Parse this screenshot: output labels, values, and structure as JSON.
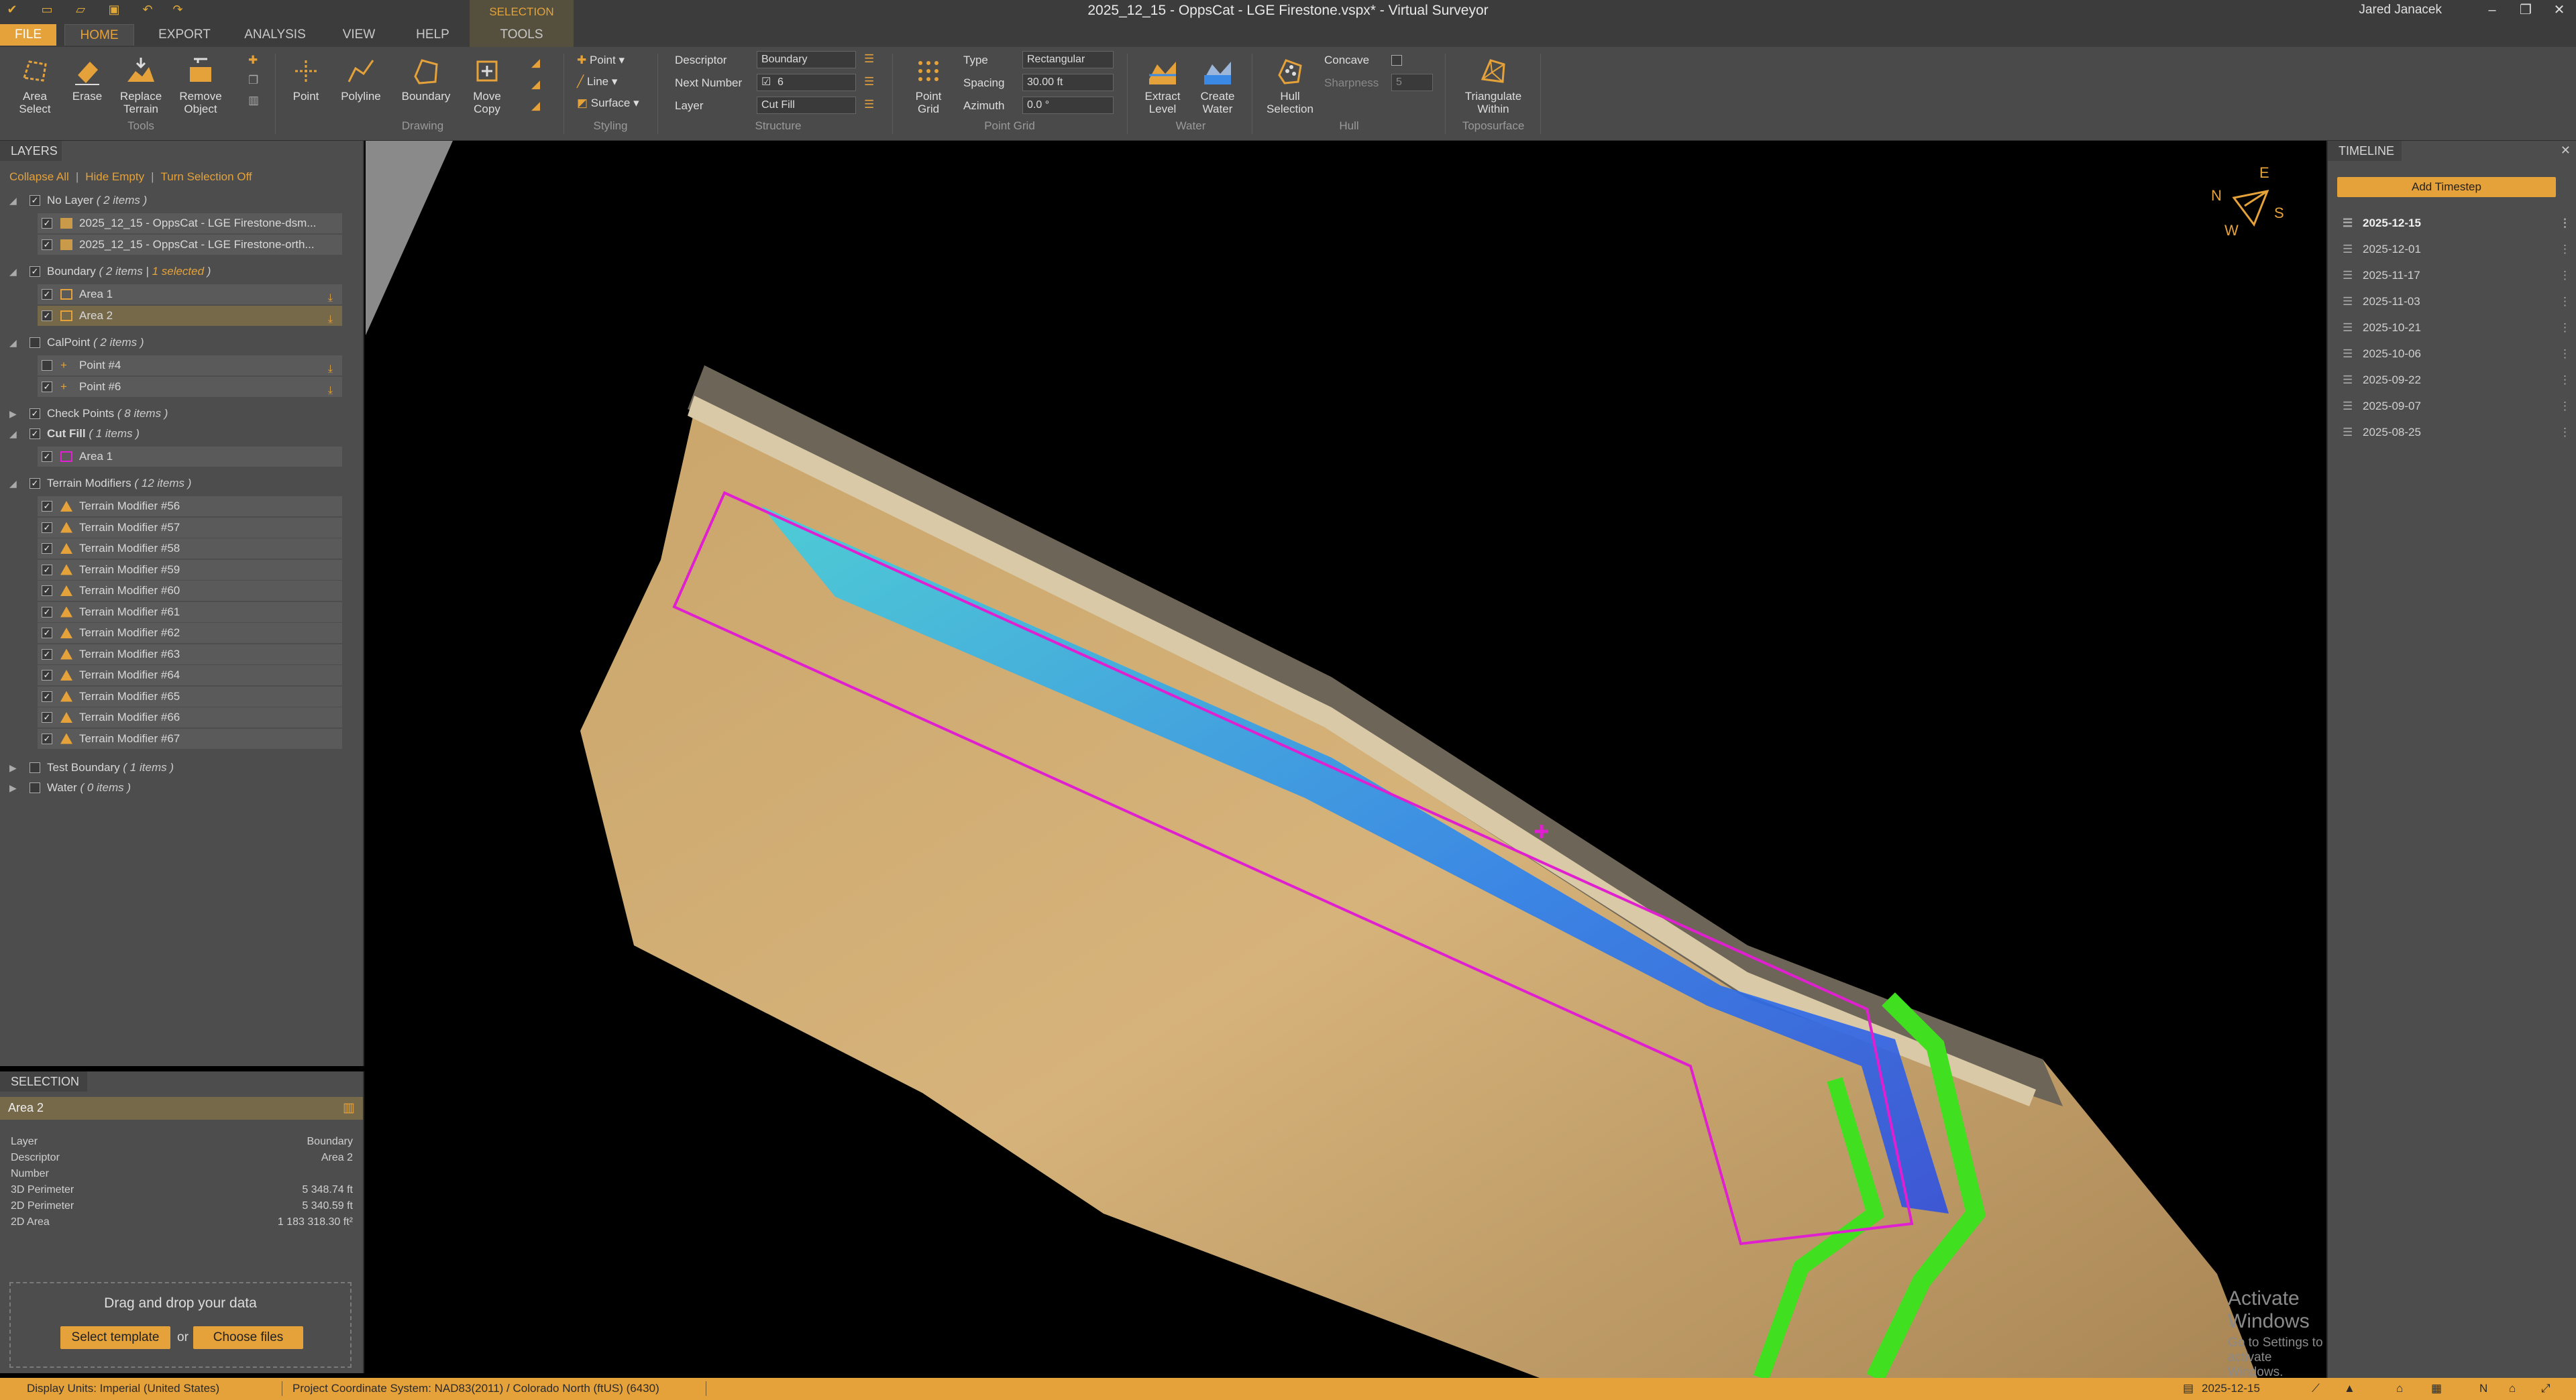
{
  "window": {
    "title": "2025_12_15 - OppsCat - LGE Firestone.vspx* - Virtual Surveyor",
    "user": "Jared Janacek"
  },
  "tabs": {
    "file": "FILE",
    "home": "HOME",
    "export": "EXPORT",
    "analysis": "ANALYSIS",
    "view": "VIEW",
    "help": "HELP",
    "context_group": "SELECTION",
    "tools": "TOOLS"
  },
  "ribbon": {
    "tools": {
      "label": "Tools",
      "area_select": "Area\nSelect",
      "erase": "Erase",
      "replace_terrain": "Replace\nTerrain",
      "remove_object": "Remove\nObject"
    },
    "drawing": {
      "label": "Drawing",
      "point": "Point",
      "polyline": "Polyline",
      "boundary": "Boundary",
      "move_copy": "Move\nCopy"
    },
    "styling": {
      "label": "Styling",
      "point": "Point",
      "line": "Line",
      "surface": "Surface"
    },
    "structure": {
      "label": "Structure",
      "descriptor_label": "Descriptor",
      "descriptor_value": "Boundary",
      "next_number_label": "Next Number",
      "next_number_value": "6",
      "layer_label": "Layer",
      "layer_value": "Cut Fill"
    },
    "point_grid": {
      "label": "Point Grid",
      "button": "Point\nGrid",
      "type_label": "Type",
      "type_value": "Rectangular",
      "spacing_label": "Spacing",
      "spacing_value": "30.00 ft",
      "azimuth_label": "Azimuth",
      "azimuth_value": "0.0 °"
    },
    "water": {
      "label": "Water",
      "extract_level": "Extract\nLevel",
      "create_water": "Create\nWater"
    },
    "hull": {
      "label": "Hull",
      "hull_selection": "Hull\nSelection",
      "concave_label": "Concave",
      "sharpness_label": "Sharpness",
      "sharpness_value": "5"
    },
    "toposurface": {
      "label": "Toposurface",
      "triangulate_within": "Triangulate\nWithin"
    }
  },
  "layers": {
    "header": "LAYERS",
    "collapse_all": "Collapse All",
    "hide_empty": "Hide Empty",
    "turn_selection_off": "Turn Selection Off",
    "groups": [
      {
        "name": "No Layer",
        "count": "( 2 items )",
        "checked": true,
        "items": [
          "2025_12_15 - OppsCat - LGE Firestone-dsm...",
          "2025_12_15 - OppsCat - LGE Firestone-orth..."
        ]
      },
      {
        "name": "Boundary",
        "count": "( 2 items | ",
        "selected": "1 selected",
        "count_end": " )",
        "checked": true,
        "items": [
          "Area 1",
          "Area 2"
        ]
      },
      {
        "name": "CalPoint",
        "count": "( 2 items )",
        "checked": false,
        "items": [
          "Point #4",
          "Point #6"
        ]
      },
      {
        "name": "Check Points",
        "count": "( 8 items )",
        "checked": true
      },
      {
        "name": "Cut Fill",
        "count": "( 1 items )",
        "checked": true,
        "items": [
          "Area 1"
        ]
      },
      {
        "name": "Terrain Modifiers",
        "count": "( 12 items )",
        "checked": true,
        "items": [
          "Terrain Modifier #56",
          "Terrain Modifier #57",
          "Terrain Modifier #58",
          "Terrain Modifier #59",
          "Terrain Modifier #60",
          "Terrain Modifier #61",
          "Terrain Modifier #62",
          "Terrain Modifier #63",
          "Terrain Modifier #64",
          "Terrain Modifier #65",
          "Terrain Modifier #66",
          "Terrain Modifier #67"
        ]
      },
      {
        "name": "Test Boundary",
        "count": "( 1 items )",
        "checked": false
      },
      {
        "name": "Water",
        "count": "( 0 items )",
        "checked": false
      }
    ]
  },
  "selection": {
    "header": "SELECTION",
    "name": "Area 2",
    "props": [
      {
        "k": "Layer",
        "v": "Boundary"
      },
      {
        "k": "Descriptor",
        "v": "Area 2"
      },
      {
        "k": "Number",
        "v": ""
      },
      {
        "k": "3D Perimeter",
        "v": "5 348.74 ft"
      },
      {
        "k": "2D Perimeter",
        "v": "5 340.59 ft"
      },
      {
        "k": "2D Area",
        "v": "1 183 318.30 ft²"
      }
    ],
    "drop_text": "Drag and drop your data",
    "select_template": "Select template",
    "or": "or",
    "choose_files": "Choose files"
  },
  "timeline": {
    "header": "TIMELINE",
    "add_timestep": "Add Timestep",
    "dates": [
      "2025-12-15",
      "2025-12-01",
      "2025-11-17",
      "2025-11-03",
      "2025-10-21",
      "2025-10-06",
      "2025-09-22",
      "2025-09-07",
      "2025-08-25"
    ]
  },
  "compass": {
    "n": "N",
    "e": "E",
    "s": "S",
    "w": "W"
  },
  "watermark": {
    "line1": "Activate Windows",
    "line2": "Go to Settings to activate Windows."
  },
  "status": {
    "display_units": "Display Units:  Imperial (United States)",
    "coord_system": "Project Coordinate System:  NAD83(2011) / Colorado North (ftUS) (6430)",
    "date": "2025-12-15"
  },
  "colors": {
    "accent": "#e5a23a",
    "boundary": "#e020d0",
    "cut": "#2080ff",
    "fill": "#40e020"
  }
}
